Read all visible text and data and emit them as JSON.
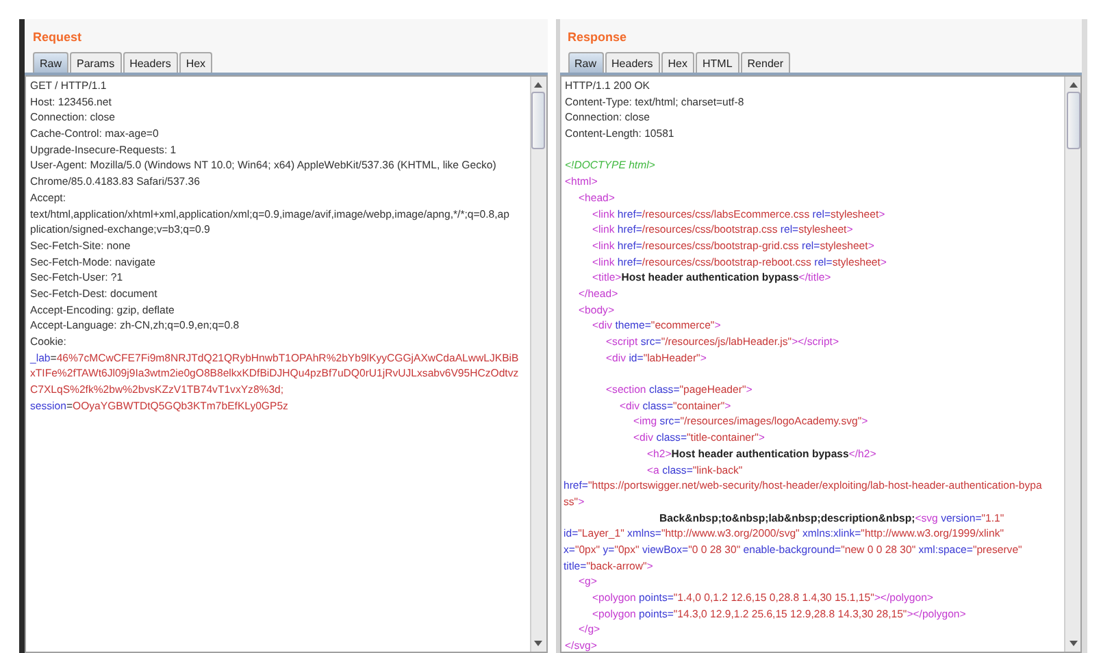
{
  "request": {
    "title": "Request",
    "tabs": [
      {
        "label": "Raw",
        "selected": true
      },
      {
        "label": "Params",
        "selected": false
      },
      {
        "label": "Headers",
        "selected": false
      },
      {
        "label": "Hex",
        "selected": false
      }
    ],
    "lines": [
      {
        "kind": "line",
        "tokens": [
          {
            "kind": "plain",
            "text": "GET / HTTP/1.1"
          }
        ]
      },
      {
        "kind": "line",
        "tokens": [
          {
            "kind": "plain",
            "text": "Host: 123456.net"
          }
        ]
      },
      {
        "kind": "line",
        "tokens": [
          {
            "kind": "plain",
            "text": "Connection: close"
          }
        ]
      },
      {
        "kind": "line",
        "tokens": [
          {
            "kind": "plain",
            "text": "Cache-Control: max-age=0"
          }
        ]
      },
      {
        "kind": "line",
        "tokens": [
          {
            "kind": "plain",
            "text": "Upgrade-Insecure-Requests: 1"
          }
        ]
      },
      {
        "kind": "line",
        "tokens": [
          {
            "kind": "plain",
            "text": "User-Agent: Mozilla/5.0 (Windows NT 10.0; Win64; x64) AppleWebKit/537.36 (KHTML, like Gecko)"
          }
        ]
      },
      {
        "kind": "line",
        "tokens": [
          {
            "kind": "plain",
            "text": "Chrome/85.0.4183.83 Safari/537.36"
          }
        ]
      },
      {
        "kind": "line",
        "tokens": [
          {
            "kind": "plain",
            "text": "Accept:"
          }
        ]
      },
      {
        "kind": "line",
        "tokens": [
          {
            "kind": "plain",
            "text": "text/html,application/xhtml+xml,application/xml;q=0.9,image/avif,image/webp,image/apng,*/*;q=0.8,ap"
          }
        ]
      },
      {
        "kind": "line",
        "tokens": [
          {
            "kind": "plain",
            "text": "plication/signed-exchange;v=b3;q=0.9"
          }
        ]
      },
      {
        "kind": "line",
        "tokens": [
          {
            "kind": "plain",
            "text": "Sec-Fetch-Site: none"
          }
        ]
      },
      {
        "kind": "line",
        "tokens": [
          {
            "kind": "plain",
            "text": "Sec-Fetch-Mode: navigate"
          }
        ]
      },
      {
        "kind": "line",
        "tokens": [
          {
            "kind": "plain",
            "text": "Sec-Fetch-User: ?1"
          }
        ]
      },
      {
        "kind": "line",
        "tokens": [
          {
            "kind": "plain",
            "text": "Sec-Fetch-Dest: document"
          }
        ]
      },
      {
        "kind": "line",
        "tokens": [
          {
            "kind": "plain",
            "text": "Accept-Encoding: gzip, deflate"
          }
        ]
      },
      {
        "kind": "line",
        "tokens": [
          {
            "kind": "plain",
            "text": "Accept-Language: zh-CN,zh;q=0.9,en;q=0.8"
          }
        ]
      },
      {
        "kind": "line",
        "tokens": [
          {
            "kind": "plain",
            "text": "Cookie:"
          }
        ]
      },
      {
        "kind": "line",
        "tokens": [
          {
            "kind": "attr",
            "text": "_lab"
          },
          {
            "kind": "plain",
            "text": "="
          },
          {
            "kind": "value",
            "text": "46%7cMCwCFE7Fi9m8NRJTdQ21QRybHnwbT1OPAhR%2bYb9lKyyCGGjAXwCdaALwwLJKBiB"
          }
        ]
      },
      {
        "kind": "line",
        "tokens": [
          {
            "kind": "value",
            "text": "xTIFe%2fTAWt6Jl09j9Ia3wtm2ie0gO8B8elkxKDfBiDJHQu4pzBf7uDQ0rU1jRvUJLxsabv6V95HCzOdtvz"
          }
        ]
      },
      {
        "kind": "line",
        "tokens": [
          {
            "kind": "value",
            "text": "C7XLqS%2fk%2bw%2bvsKZzV1TB74vT1vxYz8%3d;"
          }
        ]
      },
      {
        "kind": "line",
        "tokens": [
          {
            "kind": "attr",
            "text": "session"
          },
          {
            "kind": "plain",
            "text": "="
          },
          {
            "kind": "value",
            "text": "OOyaYGBWTDtQ5GQb3KTm7bEfKLy0GP5z"
          }
        ]
      }
    ]
  },
  "response": {
    "title": "Response",
    "tabs": [
      {
        "label": "Raw",
        "selected": true
      },
      {
        "label": "Headers",
        "selected": false
      },
      {
        "label": "Hex",
        "selected": false
      },
      {
        "label": "HTML",
        "selected": false
      },
      {
        "label": "Render",
        "selected": false
      }
    ],
    "lines": [
      {
        "kind": "line",
        "tokens": [
          {
            "kind": "plain",
            "text": "HTTP/1.1 200 OK"
          }
        ]
      },
      {
        "kind": "line",
        "tokens": [
          {
            "kind": "plain",
            "text": "Content-Type: text/html; charset=utf-8"
          }
        ]
      },
      {
        "kind": "line",
        "tokens": [
          {
            "kind": "plain",
            "text": "Connection: close"
          }
        ]
      },
      {
        "kind": "line",
        "tokens": [
          {
            "kind": "plain",
            "text": "Content-Length: 10581"
          }
        ]
      },
      {
        "kind": "blank"
      },
      {
        "kind": "line",
        "tokens": [
          {
            "kind": "comment",
            "text": "<!DOCTYPE html>"
          }
        ]
      },
      {
        "kind": "line",
        "tokens": [
          {
            "kind": "tag",
            "text": "<html>"
          }
        ],
        "children": [
          {
            "kind": "line",
            "tokens": [
              {
                "kind": "tag",
                "text": "<head>"
              }
            ],
            "children": [
              {
                "kind": "line",
                "tokens": [
                  {
                    "kind": "tag",
                    "text": "<link "
                  },
                  {
                    "kind": "attr",
                    "text": "href="
                  },
                  {
                    "kind": "value",
                    "text": "/resources/css/labsEcommerce.css "
                  },
                  {
                    "kind": "attr",
                    "text": "rel="
                  },
                  {
                    "kind": "value",
                    "text": "stylesheet"
                  },
                  {
                    "kind": "tag",
                    "text": ">"
                  }
                ]
              },
              {
                "kind": "line",
                "tokens": [
                  {
                    "kind": "tag",
                    "text": "<link "
                  },
                  {
                    "kind": "attr",
                    "text": "href="
                  },
                  {
                    "kind": "value",
                    "text": "/resources/css/bootstrap.css "
                  },
                  {
                    "kind": "attr",
                    "text": "rel="
                  },
                  {
                    "kind": "value",
                    "text": "stylesheet"
                  },
                  {
                    "kind": "tag",
                    "text": ">"
                  }
                ]
              },
              {
                "kind": "line",
                "tokens": [
                  {
                    "kind": "tag",
                    "text": "<link "
                  },
                  {
                    "kind": "attr",
                    "text": "href="
                  },
                  {
                    "kind": "value",
                    "text": "/resources/css/bootstrap-grid.css "
                  },
                  {
                    "kind": "attr",
                    "text": "rel="
                  },
                  {
                    "kind": "value",
                    "text": "stylesheet"
                  },
                  {
                    "kind": "tag",
                    "text": ">"
                  }
                ]
              },
              {
                "kind": "line",
                "tokens": [
                  {
                    "kind": "tag",
                    "text": "<link "
                  },
                  {
                    "kind": "attr",
                    "text": "href="
                  },
                  {
                    "kind": "value",
                    "text": "/resources/css/bootstrap-reboot.css "
                  },
                  {
                    "kind": "attr",
                    "text": "rel="
                  },
                  {
                    "kind": "value",
                    "text": "stylesheet"
                  },
                  {
                    "kind": "tag",
                    "text": ">"
                  }
                ]
              },
              {
                "kind": "line",
                "tokens": [
                  {
                    "kind": "tag",
                    "text": "<title>"
                  },
                  {
                    "kind": "bold",
                    "text": "Host header authentication bypass"
                  },
                  {
                    "kind": "tag",
                    "text": "</title>"
                  }
                ]
              }
            ]
          },
          {
            "kind": "line",
            "tokens": [
              {
                "kind": "tag",
                "text": "</head>"
              }
            ]
          },
          {
            "kind": "line",
            "tokens": [
              {
                "kind": "tag",
                "text": "<body>"
              }
            ],
            "children": [
              {
                "kind": "line",
                "tokens": [
                  {
                    "kind": "tag",
                    "text": "<div "
                  },
                  {
                    "kind": "attr",
                    "text": "theme="
                  },
                  {
                    "kind": "value",
                    "text": "\"ecommerce\""
                  },
                  {
                    "kind": "tag",
                    "text": ">"
                  }
                ],
                "children": [
                  {
                    "kind": "line",
                    "tokens": [
                      {
                        "kind": "tag",
                        "text": "<script "
                      },
                      {
                        "kind": "attr",
                        "text": "src="
                      },
                      {
                        "kind": "value",
                        "text": "\"/resources/js/labHeader.js\""
                      },
                      {
                        "kind": "tag",
                        "text": "></script>"
                      }
                    ]
                  },
                  {
                    "kind": "line",
                    "tokens": [
                      {
                        "kind": "tag",
                        "text": "<div "
                      },
                      {
                        "kind": "attr",
                        "text": "id="
                      },
                      {
                        "kind": "value",
                        "text": "\"labHeader\""
                      },
                      {
                        "kind": "tag",
                        "text": ">"
                      }
                    ]
                  },
                  {
                    "kind": "blank"
                  },
                  {
                    "kind": "line",
                    "tokens": [
                      {
                        "kind": "tag",
                        "text": "<section "
                      },
                      {
                        "kind": "attr",
                        "text": "class="
                      },
                      {
                        "kind": "value",
                        "text": "\"pageHeader\""
                      },
                      {
                        "kind": "tag",
                        "text": ">"
                      }
                    ],
                    "children": [
                      {
                        "kind": "line",
                        "tokens": [
                          {
                            "kind": "tag",
                            "text": "<div "
                          },
                          {
                            "kind": "attr",
                            "text": "class="
                          },
                          {
                            "kind": "value",
                            "text": "\"container\""
                          },
                          {
                            "kind": "tag",
                            "text": ">"
                          }
                        ],
                        "children": [
                          {
                            "kind": "line",
                            "tokens": [
                              {
                                "kind": "tag",
                                "text": "<img "
                              },
                              {
                                "kind": "attr",
                                "text": "src="
                              },
                              {
                                "kind": "value",
                                "text": "\"/resources/images/logoAcademy.svg\""
                              },
                              {
                                "kind": "tag",
                                "text": ">"
                              }
                            ]
                          },
                          {
                            "kind": "line",
                            "tokens": [
                              {
                                "kind": "tag",
                                "text": "<div "
                              },
                              {
                                "kind": "attr",
                                "text": "class="
                              },
                              {
                                "kind": "value",
                                "text": "\"title-container\""
                              },
                              {
                                "kind": "tag",
                                "text": ">"
                              }
                            ],
                            "children": [
                              {
                                "kind": "line",
                                "tokens": [
                                  {
                                    "kind": "tag",
                                    "text": "<h2>"
                                  },
                                  {
                                    "kind": "bold",
                                    "text": "Host header authentication bypass"
                                  },
                                  {
                                    "kind": "tag",
                                    "text": "</h2>"
                                  }
                                ]
                              },
                              {
                                "kind": "line",
                                "tokens": [
                                  {
                                    "kind": "tag",
                                    "text": "<a "
                                  },
                                  {
                                    "kind": "attr",
                                    "text": "class="
                                  },
                                  {
                                    "kind": "value",
                                    "text": "\"link-back\""
                                  }
                                ]
                              },
                              {
                                "kind": "wrap",
                                "tokens": [
                                  {
                                    "kind": "attr",
                                    "text": "href="
                                  },
                                  {
                                    "kind": "value",
                                    "text": "\"https://portswigger.net/web-security/host-header/exploiting/lab-host-header-authentication-bypa"
                                  }
                                ]
                              },
                              {
                                "kind": "wrap",
                                "tokens": [
                                  {
                                    "kind": "value",
                                    "text": "ss\""
                                  },
                                  {
                                    "kind": "tag",
                                    "text": ">"
                                  }
                                ]
                              },
                              {
                                "kind": "wrap-indent",
                                "tokens": [
                                  {
                                    "kind": "bold",
                                    "text": "Back&nbsp;to&nbsp;lab&nbsp;description&nbsp;"
                                  },
                                  {
                                    "kind": "tag",
                                    "text": "<svg "
                                  },
                                  {
                                    "kind": "attr",
                                    "text": "version="
                                  },
                                  {
                                    "kind": "value",
                                    "text": "\"1.1\""
                                  }
                                ]
                              },
                              {
                                "kind": "wrap",
                                "tokens": [
                                  {
                                    "kind": "attr",
                                    "text": "id="
                                  },
                                  {
                                    "kind": "value",
                                    "text": "\"Layer_1\" "
                                  },
                                  {
                                    "kind": "attr",
                                    "text": "xmlns="
                                  },
                                  {
                                    "kind": "value",
                                    "text": "\"http://www.w3.org/2000/svg\" "
                                  },
                                  {
                                    "kind": "attr",
                                    "text": "xmlns:xlink="
                                  },
                                  {
                                    "kind": "value",
                                    "text": "\"http://www.w3.org/1999/xlink\""
                                  }
                                ]
                              },
                              {
                                "kind": "wrap",
                                "tokens": [
                                  {
                                    "kind": "attr",
                                    "text": "x="
                                  },
                                  {
                                    "kind": "value",
                                    "text": "\"0px\" "
                                  },
                                  {
                                    "kind": "attr",
                                    "text": "y="
                                  },
                                  {
                                    "kind": "value",
                                    "text": "\"0px\" "
                                  },
                                  {
                                    "kind": "attr",
                                    "text": "viewBox="
                                  },
                                  {
                                    "kind": "value",
                                    "text": "\"0 0 28 30\" "
                                  },
                                  {
                                    "kind": "attr",
                                    "text": "enable-background="
                                  },
                                  {
                                    "kind": "value",
                                    "text": "\"new 0 0 28 30\" "
                                  },
                                  {
                                    "kind": "attr",
                                    "text": "xml:space="
                                  },
                                  {
                                    "kind": "value",
                                    "text": "\"preserve\""
                                  }
                                ]
                              },
                              {
                                "kind": "wrap",
                                "tokens": [
                                  {
                                    "kind": "attr",
                                    "text": "title="
                                  },
                                  {
                                    "kind": "value",
                                    "text": "\"back-arrow\""
                                  },
                                  {
                                    "kind": "tag",
                                    "text": ">"
                                  }
                                ]
                              }
                            ]
                          }
                        ]
                      }
                    ]
                  }
                ]
              }
            ]
          },
          {
            "kind": "line",
            "tokens": [
              {
                "kind": "tag",
                "text": "<g>"
              }
            ],
            "children": [
              {
                "kind": "line",
                "tokens": [
                  {
                    "kind": "tag",
                    "text": "<polygon "
                  },
                  {
                    "kind": "attr",
                    "text": "points="
                  },
                  {
                    "kind": "value",
                    "text": "\"1.4,0 0,1.2 12.6,15 0,28.8 1.4,30 15.1,15\""
                  },
                  {
                    "kind": "tag",
                    "text": "></polygon>"
                  }
                ]
              },
              {
                "kind": "line",
                "tokens": [
                  {
                    "kind": "tag",
                    "text": "<polygon "
                  },
                  {
                    "kind": "attr",
                    "text": "points="
                  },
                  {
                    "kind": "value",
                    "text": "\"14.3,0 12.9,1.2 25.6,15 12.9,28.8 14.3,30 28,15\""
                  },
                  {
                    "kind": "tag",
                    "text": "></polygon>"
                  }
                ]
              }
            ]
          },
          {
            "kind": "line",
            "tokens": [
              {
                "kind": "tag",
                "text": "</g>"
              }
            ]
          }
        ]
      },
      {
        "kind": "line",
        "tokens": [
          {
            "kind": "tag",
            "text": "</svg>"
          }
        ]
      }
    ]
  }
}
